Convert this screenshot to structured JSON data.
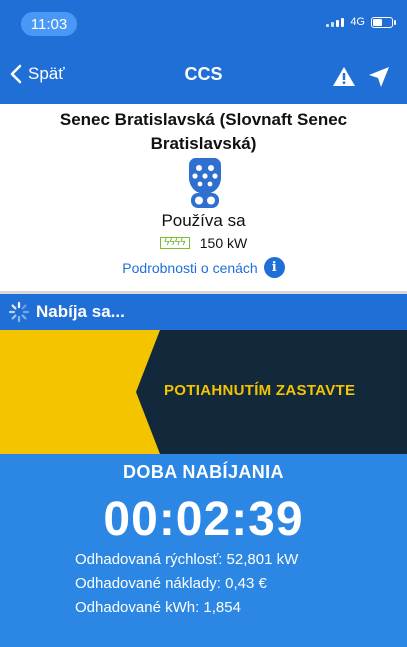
{
  "status_bar": {
    "time": "11:03",
    "network": "4G"
  },
  "nav": {
    "back_label": "Späť",
    "title": "CCS"
  },
  "station": {
    "name": "Senec Bratislavská (Slovnaft Senec Bratislavská)",
    "status": "Používa sa",
    "power": "150 kW",
    "price_link": "Podrobnosti o cenách"
  },
  "charging": {
    "label": "Nabíja sa...",
    "slider_text": "POTIAHNUTÍM ZASTAVTE"
  },
  "session": {
    "duration_label": "DOBA NABÍJANIA",
    "timer": "00:02:39",
    "speed": "Odhadovaná rýchlosť: 52,801 kW",
    "cost": "Odhadované náklady: 0,43 €",
    "kwh": "Odhadované kWh: 1,854"
  },
  "colors": {
    "primary_blue": "#1f6fd6",
    "panel_blue": "#2b87e3",
    "slider_dark": "#12283b",
    "slider_yellow": "#f4c400"
  }
}
